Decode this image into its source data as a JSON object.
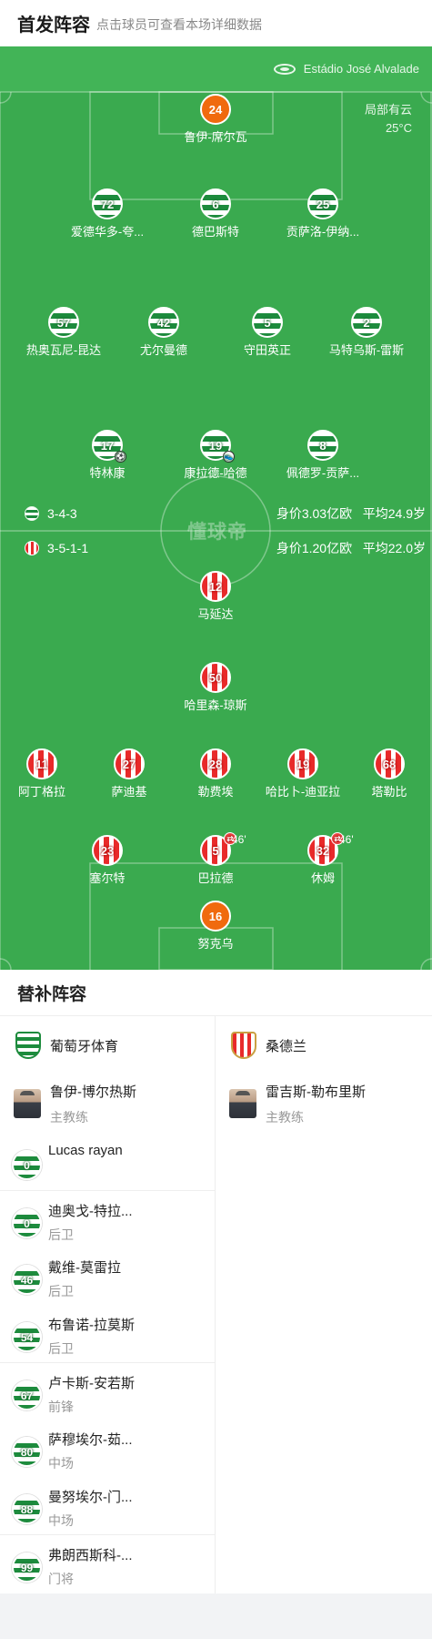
{
  "header": {
    "title": "首发阵容",
    "subtitle": "点击球员可查看本场详细数据"
  },
  "pitch": {
    "stadium": "Estádio José Alvalade",
    "weather": "局部有云",
    "temperature": "25°C",
    "watermark": "懂球帝",
    "home_form": {
      "formation": "3-4-3",
      "value": "身价3.03亿欧",
      "age": "平均24.9岁"
    },
    "away_form": {
      "formation": "3-5-1-1",
      "value": "身价1.20亿欧",
      "age": "平均22.0岁"
    },
    "home_players": [
      {
        "num": "24",
        "name": "鲁伊-席尔瓦",
        "kit": "gk-home"
      },
      {
        "num": "72",
        "name": "爱德华多-夸...",
        "kit": "sporting"
      },
      {
        "num": "6",
        "name": "德巴斯特",
        "kit": "sporting"
      },
      {
        "num": "25",
        "name": "贡萨洛-伊纳...",
        "kit": "sporting"
      },
      {
        "num": "57",
        "name": "热奥瓦尼-昆达",
        "kit": "sporting"
      },
      {
        "num": "42",
        "name": "尤尔曼德",
        "kit": "sporting"
      },
      {
        "num": "5",
        "name": "守田英正",
        "kit": "sporting"
      },
      {
        "num": "2",
        "name": "马特乌斯-雷斯",
        "kit": "sporting"
      },
      {
        "num": "17",
        "name": "特林康",
        "kit": "sporting",
        "goal": "⚽"
      },
      {
        "num": "19",
        "name": "康拉德-哈德",
        "kit": "sporting",
        "assist": "👟"
      },
      {
        "num": "8",
        "name": "佩德罗-贡萨...",
        "kit": "sporting"
      }
    ],
    "away_players": [
      {
        "num": "12",
        "name": "马延达",
        "kit": "sunder"
      },
      {
        "num": "50",
        "name": "哈里森-琼斯",
        "kit": "sunder"
      },
      {
        "num": "11",
        "name": "阿丁格拉",
        "kit": "sunder"
      },
      {
        "num": "27",
        "name": "萨迪基",
        "kit": "sunder"
      },
      {
        "num": "28",
        "name": "勒费埃",
        "kit": "sunder"
      },
      {
        "num": "19",
        "name": "哈比卜-迪亚拉",
        "kit": "sunder"
      },
      {
        "num": "68",
        "name": "塔勒比",
        "kit": "sunder"
      },
      {
        "num": "23",
        "name": "塞尔特",
        "kit": "sunder"
      },
      {
        "num": "5",
        "name": "巴拉德",
        "kit": "sunder",
        "sub_min": "46'"
      },
      {
        "num": "32",
        "name": "休姆",
        "kit": "sunder",
        "sub_min": "46'"
      },
      {
        "num": "16",
        "name": "努克乌",
        "kit": "gk-away"
      }
    ]
  },
  "subs": {
    "title": "替补阵容",
    "home": {
      "team": "葡萄牙体育",
      "coach": {
        "name": "鲁伊-博尔热斯",
        "role": "主教练"
      },
      "players": [
        {
          "num": "0",
          "name": "Lucas rayan",
          "pos": ""
        },
        {
          "num": "0",
          "name": "迪奥戈-特拉...",
          "pos": "后卫"
        },
        {
          "num": "46",
          "name": "戴维-莫雷拉",
          "pos": "后卫"
        },
        {
          "num": "54",
          "name": "布鲁诺-拉莫斯",
          "pos": "后卫"
        },
        {
          "num": "67",
          "name": "卢卡斯-安若斯",
          "pos": "前锋"
        },
        {
          "num": "80",
          "name": "萨穆埃尔-茹...",
          "pos": "中场"
        },
        {
          "num": "88",
          "name": "曼努埃尔-门...",
          "pos": "中场"
        },
        {
          "num": "99",
          "name": "弗朗西斯科-...",
          "pos": "门将"
        }
      ]
    },
    "away": {
      "team": "桑德兰",
      "coach": {
        "name": "雷吉斯-勒布里斯",
        "role": "主教练"
      }
    }
  }
}
